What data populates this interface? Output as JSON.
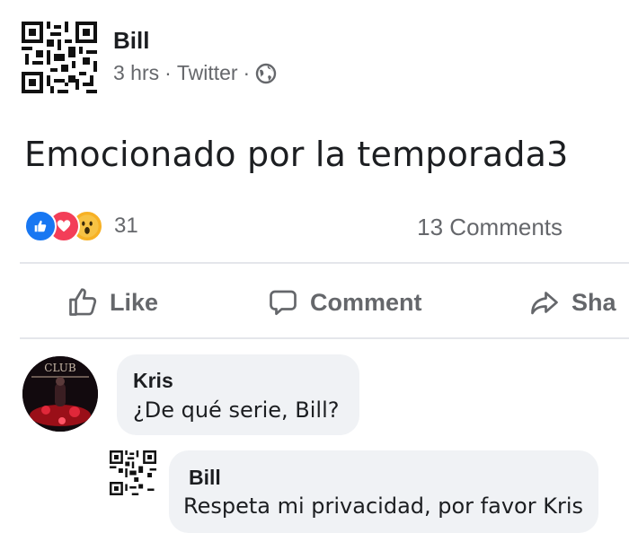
{
  "post": {
    "author": "Bill",
    "time": "3 hrs",
    "separator": "·",
    "source": "Twitter",
    "privacy_icon": "globe-icon",
    "text": "Emocionado por la temporada3",
    "reaction_icons": [
      "like-reaction-icon",
      "love-reaction-icon",
      "wow-reaction-icon"
    ],
    "reactions_count": "31",
    "comments_count": "13 Comments"
  },
  "actions": {
    "like": "Like",
    "comment": "Comment",
    "share": "Sha"
  },
  "comments": [
    {
      "author": "Kris",
      "text": "¿De qué serie, Bill?",
      "avatar_text": "CLUB"
    },
    {
      "author": "Bill",
      "text": "Respeta mi privacidad, por favor Kris"
    }
  ],
  "colors": {
    "meta_gray": "#65676b",
    "bubble_bg": "#f0f2f5",
    "like_blue": "#1877f2",
    "love_red": "#f33e58",
    "wow_yellow": "#f7b125"
  }
}
